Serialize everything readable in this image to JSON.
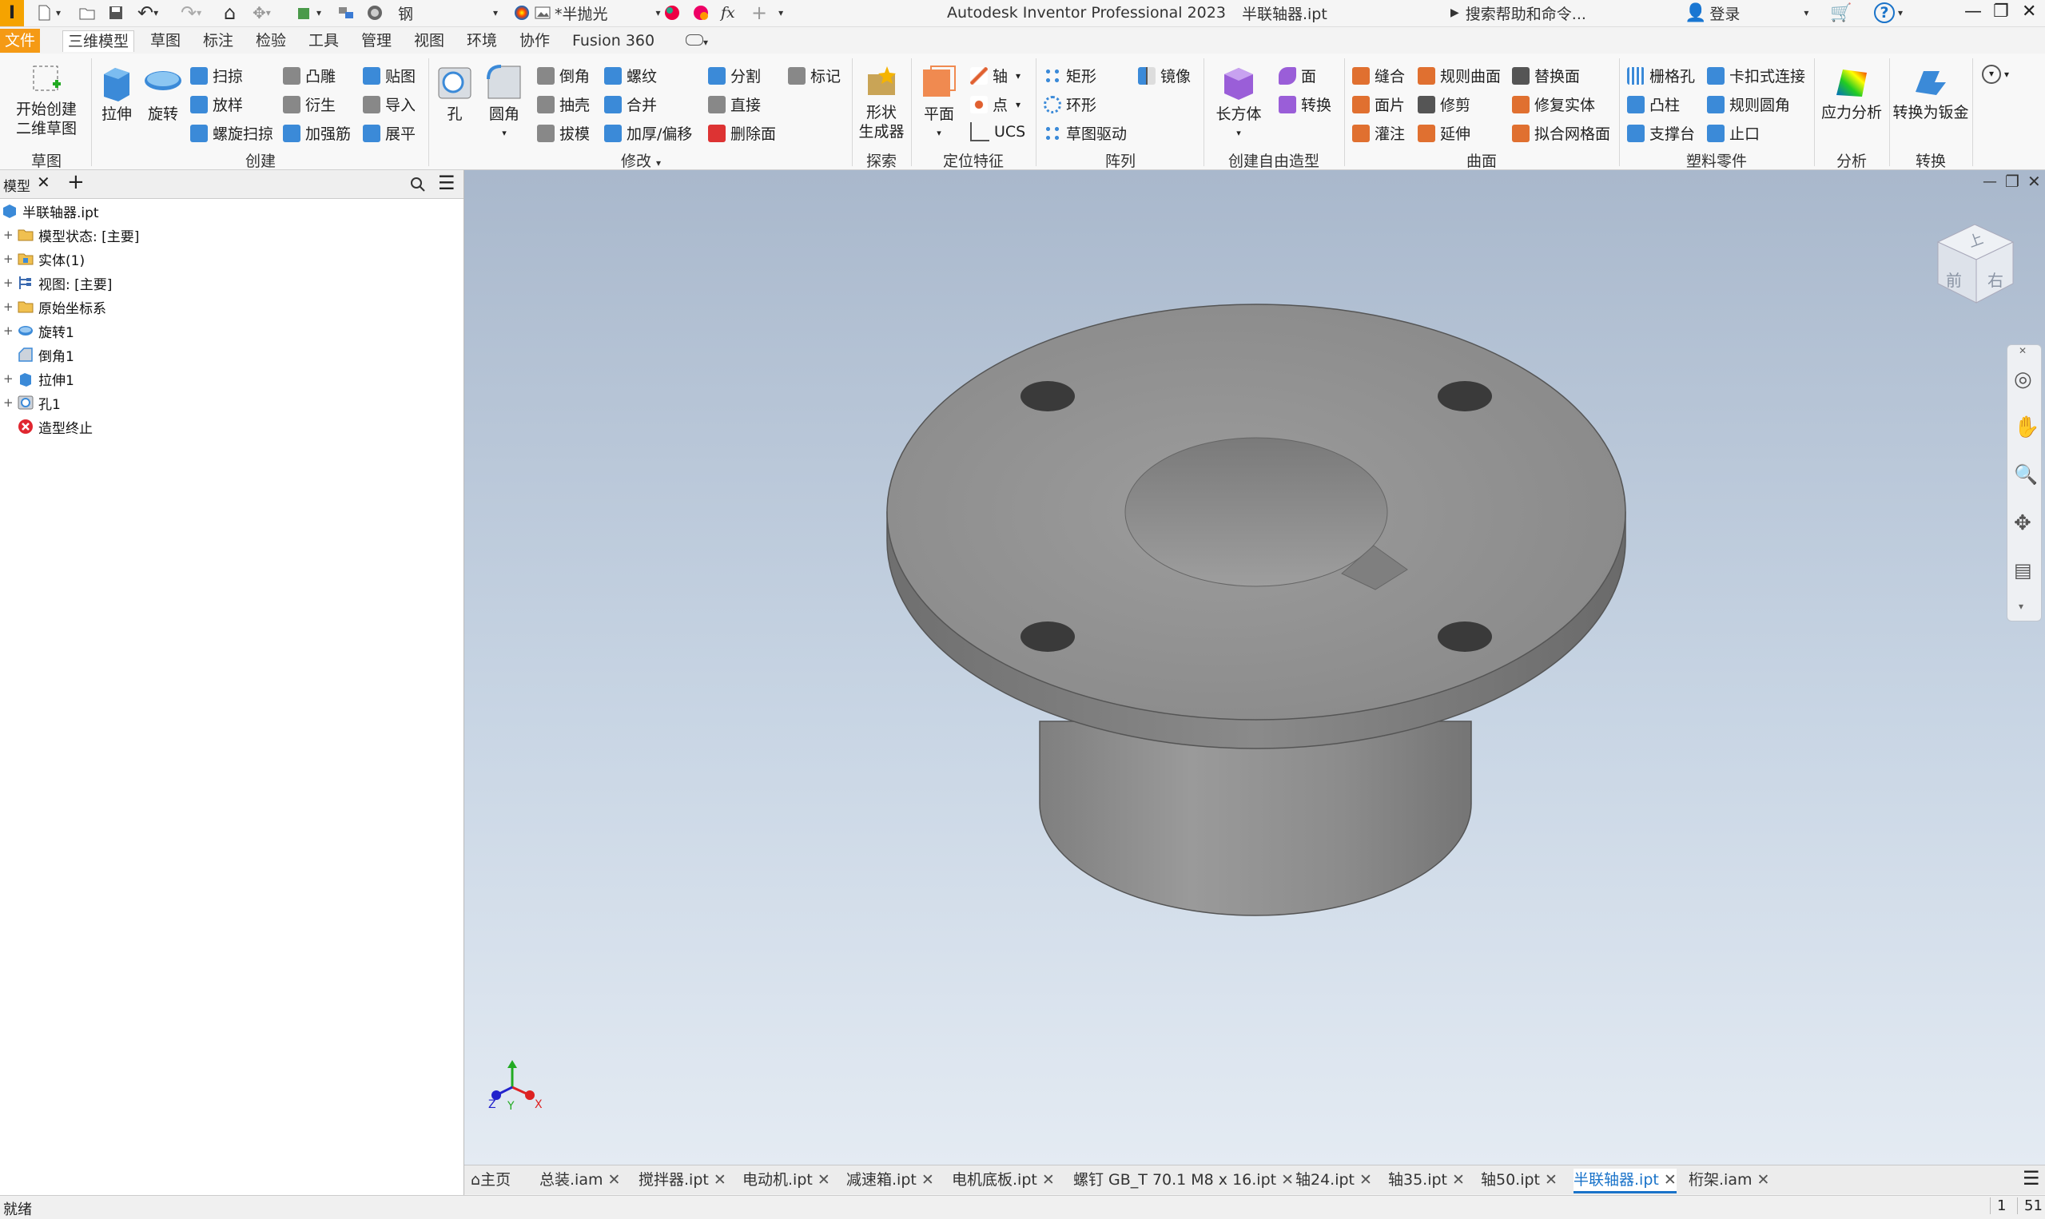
{
  "app": {
    "title": "Autodesk Inventor Professional 2023",
    "document_title": "半联轴器.ipt",
    "logo": "I"
  },
  "quick_access": {
    "material": "钢",
    "appearance": "*半抛光",
    "search_placeholder": "搜索帮助和命令...",
    "login": "登录",
    "fx": "fx"
  },
  "menu_tabs": [
    "文件",
    "三维模型",
    "草图",
    "标注",
    "检验",
    "工具",
    "管理",
    "视图",
    "环境",
    "协作",
    "Fusion 360"
  ],
  "ribbon": {
    "sketch": {
      "label": "开始创建\n二维草图",
      "line1": "开始创建",
      "line2": "二维草图",
      "group": "草图"
    },
    "create": {
      "group": "创建",
      "extrude": "拉伸",
      "revolve": "旋转",
      "sweep": "扫掠",
      "loft": "放样",
      "coil": "螺旋扫掠",
      "emboss": "凸雕",
      "derive": "衍生",
      "rib": "加强筋",
      "decal": "贴图",
      "import": "导入",
      "unwrap": "展平"
    },
    "modify": {
      "group": "修改",
      "hole": "孔",
      "fillet": "圆角",
      "chamfer": "倒角",
      "shell": "抽壳",
      "draft": "拔模",
      "thread": "螺纹",
      "combine": "合并",
      "thicken": "加厚/偏移",
      "split": "分割",
      "direct": "直接",
      "delete_face": "删除面",
      "mark": "标记"
    },
    "explore": {
      "group": "探索",
      "shape_gen_1": "形状",
      "shape_gen_2": "生成器"
    },
    "work_features": {
      "group": "定位特征",
      "plane": "平面",
      "axis": "轴",
      "point": "点",
      "ucs": "UCS"
    },
    "pattern": {
      "group": "阵列",
      "rect": "矩形",
      "circ": "环形",
      "sketch_driven": "草图驱动",
      "mirror": "镜像"
    },
    "freeform": {
      "group": "创建自由造型",
      "box": "长方体",
      "face": "面",
      "convert": "转换"
    },
    "surface": {
      "group": "曲面",
      "stitch": "缝合",
      "patch": "面片",
      "sculpt": "灌注",
      "ruled": "规则曲面",
      "trim": "修剪",
      "extend": "延伸",
      "replace": "替换面",
      "repair": "修复实体",
      "fit_mesh": "拟合网格面"
    },
    "plastic": {
      "group": "塑料零件",
      "grill": "栅格孔",
      "boss": "凸柱",
      "rest": "支撑台",
      "snap": "卡扣式连接",
      "rule_fillet": "规则圆角",
      "lip": "止口"
    },
    "analysis": {
      "group": "分析",
      "stress": "应力分析"
    },
    "convert": {
      "group": "转换",
      "sheet_metal": "转换为钣金"
    }
  },
  "browser": {
    "tab_label": "模型",
    "items": [
      {
        "label": "半联轴器.ipt",
        "expand": "",
        "indent": 0,
        "icon": "part-icon"
      },
      {
        "label": "模型状态: [主要]",
        "expand": "+",
        "indent": 1,
        "icon": "folder-icon"
      },
      {
        "label": "实体(1)",
        "expand": "+",
        "indent": 1,
        "icon": "solid-folder-icon"
      },
      {
        "label": "视图: [主要]",
        "expand": "+",
        "indent": 1,
        "icon": "view-icon"
      },
      {
        "label": "原始坐标系",
        "expand": "+",
        "indent": 1,
        "icon": "folder-icon"
      },
      {
        "label": "旋转1",
        "expand": "+",
        "indent": 1,
        "icon": "revolve-icon"
      },
      {
        "label": "倒角1",
        "expand": "",
        "indent": 1,
        "icon": "chamfer-icon"
      },
      {
        "label": "拉伸1",
        "expand": "+",
        "indent": 1,
        "icon": "extrude-icon"
      },
      {
        "label": "孔1",
        "expand": "+",
        "indent": 1,
        "icon": "hole-icon"
      },
      {
        "label": "造型终止",
        "expand": "",
        "indent": 1,
        "icon": "end-of-part-icon"
      }
    ]
  },
  "viewcube": {
    "top": "上",
    "front": "前",
    "right": "右"
  },
  "axes": {
    "x": "X",
    "y": "Y",
    "z": "Z"
  },
  "doc_tabs": [
    {
      "label": "主页",
      "closable": false,
      "active": false
    },
    {
      "label": "总装.iam",
      "closable": true,
      "active": false
    },
    {
      "label": "搅拌器.ipt",
      "closable": true,
      "active": false
    },
    {
      "label": "电动机.ipt",
      "closable": true,
      "active": false
    },
    {
      "label": "减速箱.ipt",
      "closable": true,
      "active": false
    },
    {
      "label": "电机底板.ipt",
      "closable": true,
      "active": false
    },
    {
      "label": "螺钉 GB_T 70.1 M8 x 16.ipt",
      "closable": true,
      "active": false
    },
    {
      "label": "轴24.ipt",
      "closable": true,
      "active": false
    },
    {
      "label": "轴35.ipt",
      "closable": true,
      "active": false
    },
    {
      "label": "轴50.ipt",
      "closable": true,
      "active": false
    },
    {
      "label": "半联轴器.ipt",
      "closable": true,
      "active": true
    },
    {
      "label": "桁架.iam",
      "closable": true,
      "active": false
    }
  ],
  "status": {
    "left": "就绪",
    "num1": "1",
    "num2": "51"
  },
  "colors": {
    "file_tab": "#f59a15",
    "accent": "#1a73c9",
    "model": "#8a8a8a"
  }
}
